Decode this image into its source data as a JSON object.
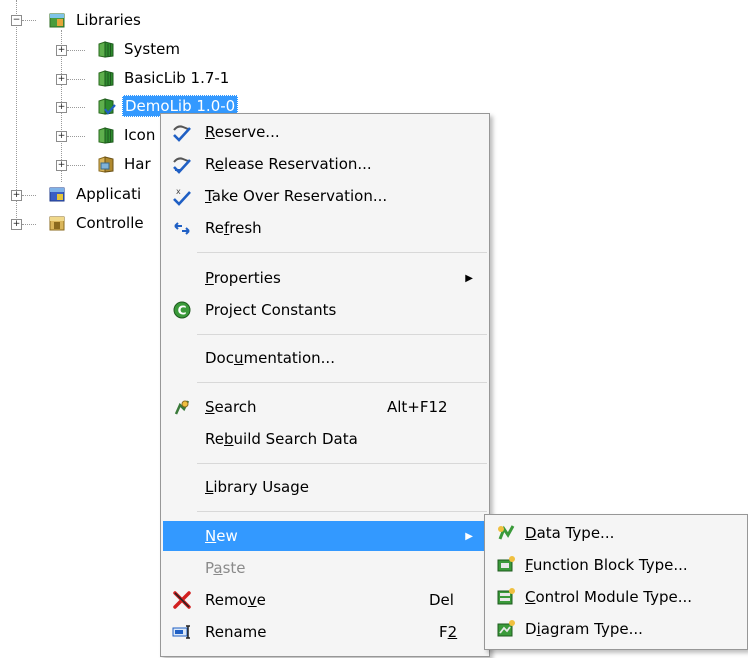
{
  "tree": {
    "root": {
      "label": "Libraries",
      "expander": "−"
    },
    "children": [
      {
        "label": "System",
        "expander": "+"
      },
      {
        "label": "BasicLib 1.7-1",
        "expander": "+"
      },
      {
        "label": "DemoLib 1.0-0",
        "expander": "+"
      },
      {
        "label": "Icon",
        "expander": "+"
      },
      {
        "label": "Har",
        "expander": "+"
      }
    ],
    "siblings": [
      {
        "label": "Applicati",
        "expander": "+"
      },
      {
        "label": "Controlle",
        "expander": "+"
      }
    ]
  },
  "context_menu": {
    "items": [
      {
        "pre": "",
        "ul": "R",
        "post": "eserve...",
        "icon": "reserve-icon"
      },
      {
        "pre": "R",
        "ul": "e",
        "post": "lease Reservation...",
        "icon": "release-reservation-icon"
      },
      {
        "pre": "",
        "ul": "T",
        "post": "ake Over Reservation...",
        "icon": "take-over-reservation-icon"
      },
      {
        "pre": "Re",
        "ul": "f",
        "post": "resh",
        "icon": "refresh-icon"
      },
      {
        "pre": "",
        "ul": "P",
        "post": "roperties",
        "icon": ""
      },
      {
        "pre": "Project Constants",
        "ul": "",
        "post": "",
        "icon": "project-constants-icon"
      },
      {
        "pre": "Doc",
        "ul": "u",
        "post": "mentation...",
        "icon": ""
      },
      {
        "pre": "",
        "ul": "S",
        "post": "earch",
        "shortcut": "Alt+F12",
        "icon": "search-icon"
      },
      {
        "pre": "Re",
        "ul": "b",
        "post": "uild Search Data",
        "icon": ""
      },
      {
        "pre": "",
        "ul": "L",
        "post": "ibrary Usage",
        "icon": ""
      },
      {
        "pre": "",
        "ul": "N",
        "post": "ew",
        "icon": ""
      },
      {
        "pre": "P",
        "ul": "a",
        "post": "ste",
        "icon": ""
      },
      {
        "pre": "Remo",
        "ul": "v",
        "post": "e",
        "shortcut": "Del",
        "icon": "remove-icon"
      },
      {
        "pre": "Rename",
        "ul": "",
        "post": "",
        "shortcut_pre": "F",
        "shortcut_ul": "2",
        "icon": "rename-icon"
      }
    ]
  },
  "submenu": {
    "items": [
      {
        "pre": "",
        "ul": "D",
        "post": "ata Type...",
        "icon": "data-type-icon"
      },
      {
        "pre": "",
        "ul": "F",
        "post": "unction Block Type...",
        "icon": "function-block-type-icon"
      },
      {
        "pre": "",
        "ul": "C",
        "post": "ontrol Module Type...",
        "icon": "control-module-type-icon"
      },
      {
        "pre": "D",
        "ul": "i",
        "post": "agram Type...",
        "icon": "diagram-type-icon"
      }
    ]
  },
  "colors": {
    "highlight": "#3399ff",
    "menu_bg": "#f5f5f5",
    "disabled": "#8a8a8a",
    "lib_green": "#2e8b2e"
  }
}
